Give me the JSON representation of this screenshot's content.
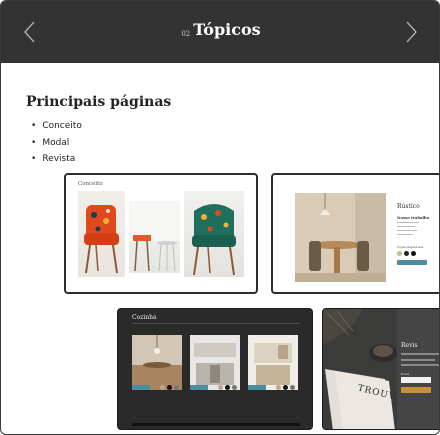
{
  "header": {
    "number": "02",
    "title": "Tópicos",
    "prev_icon": "chevron-left-icon",
    "next_icon": "chevron-right-icon"
  },
  "main": {
    "heading": "Principais páginas",
    "topics": [
      "Conceito",
      "Modal",
      "Revista"
    ]
  },
  "cards": {
    "conceito": {
      "label": "Conceito"
    },
    "modal": {
      "title": "Rústico",
      "subtitle": "Nosso trabalho",
      "swatch_label": "Cores disponíveis"
    },
    "cozinha": {
      "label": "Cozinha"
    },
    "revista": {
      "title": "Revis",
      "field_label": "Email",
      "magazine_word": "TROUVÉ"
    }
  },
  "colors": {
    "header_bg": "#333333",
    "accent_teal": "#4b8ea0",
    "chair_orange": "#e0491d",
    "chair_green": "#1f6f5c"
  }
}
